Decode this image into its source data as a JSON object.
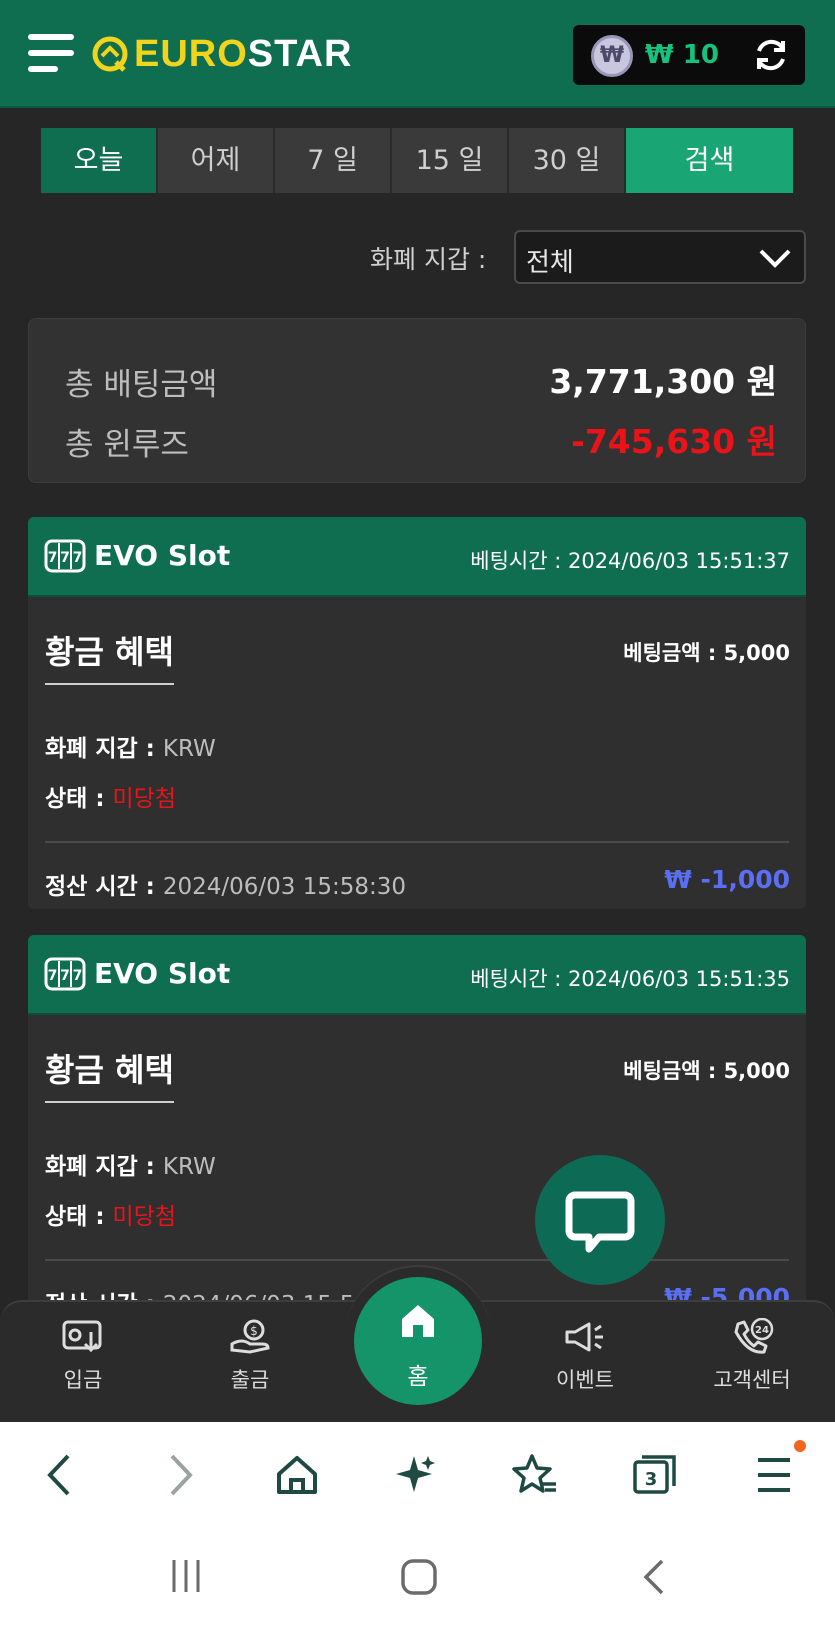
{
  "header": {
    "logo_euro": "EURO",
    "logo_star": "STAR",
    "balance": "₩ 10",
    "currency_symbol": "₩"
  },
  "tabs": [
    {
      "label": "오늘",
      "active": true
    },
    {
      "label": "어제"
    },
    {
      "label": "7 일"
    },
    {
      "label": "15 일"
    },
    {
      "label": "30 일"
    },
    {
      "label": "검색"
    }
  ],
  "filter": {
    "label": "화폐 지갑 :",
    "value": "전체"
  },
  "summary": {
    "total_bet_label": "총 배팅금액",
    "total_bet_value": "3,771,300 원",
    "total_winloss_label": "총 윈루즈",
    "total_winloss_value": "-745,630 원"
  },
  "bets": [
    {
      "game": "EVO Slot",
      "bet_time_label": "베팅시간 :",
      "bet_time": "2024/06/03 15:51:37",
      "title": "황금 혜택",
      "bet_amount_label": "베팅금액 :",
      "bet_amount": "5,000",
      "wallet_label": "화폐 지갑 :",
      "wallet": "KRW",
      "status_label": "상태 :",
      "status": "미당첨",
      "settle_label": "정산 시간 :",
      "settle_time": "2024/06/03 15:58:30",
      "result": "₩ -1,000"
    },
    {
      "game": "EVO Slot",
      "bet_time_label": "베팅시간 :",
      "bet_time": "2024/06/03 15:51:35",
      "title": "황금 혜택",
      "bet_amount_label": "베팅금액 :",
      "bet_amount": "5,000",
      "wallet_label": "화폐 지갑 :",
      "wallet": "KRW",
      "status_label": "상태 :",
      "status": "미당첨",
      "settle_label": "정산 시간 :",
      "settle_time": "2024/06/03 15:5",
      "result": "₩ -5,000"
    }
  ],
  "bottom_nav": {
    "deposit": "입금",
    "withdraw": "출금",
    "home": "홈",
    "event": "이벤트",
    "support": "고객센터",
    "support_badge": "24"
  },
  "browser": {
    "tabs_count": "3"
  },
  "colors": {
    "brand_green": "#0f6e4f",
    "accent_green": "#1aa674",
    "loss_red": "#e8141a",
    "amount_blue": "#5b6ff5"
  }
}
